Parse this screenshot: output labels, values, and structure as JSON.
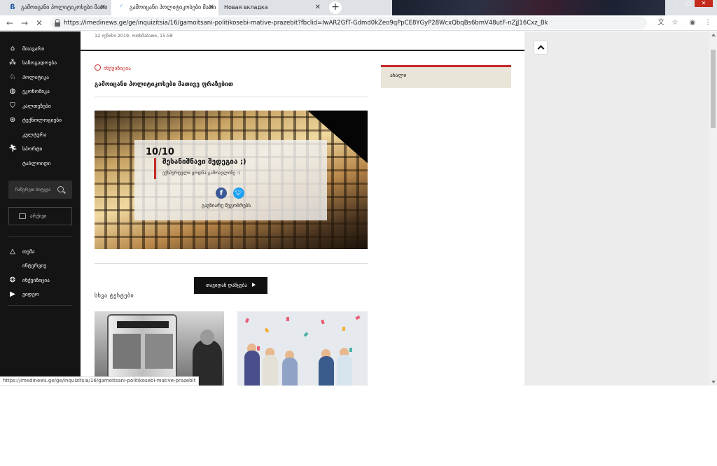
{
  "browser": {
    "tabs": [
      {
        "title": "გამოიცანი პოლიტიკოსები მათი",
        "favicon": "imedi-logo-icon"
      },
      {
        "title": "გამოიცანი პოლიტიკოსები მათი",
        "favicon": "loading-icon"
      },
      {
        "title": "Новая вкладка",
        "favicon": ""
      }
    ],
    "url": "https://imedinews.ge/ge/inquizitsia/16/gamoitsani-politikosebi-mative-prazebit?fbclid=IwAR2GfT-Gdmd0kZeo9qPpCE8YGyP28WcxQbqBs6bmV48utF-nZjJ16Cxz_Bk",
    "status_url": "https://imedinews.ge/ge/inquizitsia/16/gamoitsani-politikosebi-mative-prazebit"
  },
  "sidebar": {
    "nav": [
      {
        "label": "მთავარი",
        "icon": "home-icon"
      },
      {
        "label": "საზოგადოება",
        "icon": "society-icon"
      },
      {
        "label": "პოლიტიკა",
        "icon": "politics-icon"
      },
      {
        "label": "ეკონომიკა",
        "icon": "economy-icon"
      },
      {
        "label": "კალთეზები",
        "icon": "shield-icon"
      },
      {
        "label": "ტექნოლოგიები",
        "icon": "tech-icon"
      },
      {
        "label": "კულტურა",
        "icon": ""
      },
      {
        "label": "სპორტი",
        "icon": "sport-icon"
      },
      {
        "label": "ტაბლოიდი",
        "icon": ""
      }
    ],
    "search_placeholder": "ჩაწერეთ სიტყვა",
    "archive_label": "არქივი",
    "nav2": [
      {
        "label": "თემა",
        "icon": "triangle-icon"
      },
      {
        "label": "ინტერვიუ",
        "icon": ""
      },
      {
        "label": "ინქვიზიცია",
        "icon": "quiz-icon"
      },
      {
        "label": "ვიდეო",
        "icon": "play-icon"
      }
    ]
  },
  "article": {
    "date": "12 ივნისი 2019, ოთხშაბათი, 15:58",
    "category": "ინქვიზიცია",
    "title": "გამოიცანი პოლიტიკოსები მათივე ფრაზებით",
    "result": {
      "score": "10/10",
      "title": "შესანიშნავი შედეგია ;)",
      "subtitle": "ექსპერტული ცოდნა გამოავლინე :)",
      "share_label": "გაუზიარე მეგობრებს"
    },
    "restart_label": "თავიდან დაწყება",
    "other_tests_label": "სხვა ტესტები"
  },
  "widget": {
    "title": "ახალი"
  },
  "colors": {
    "accent": "#c62828",
    "sidebar_bg": "#141414",
    "facebook": "#3b5998",
    "twitter": "#1da1f2"
  }
}
